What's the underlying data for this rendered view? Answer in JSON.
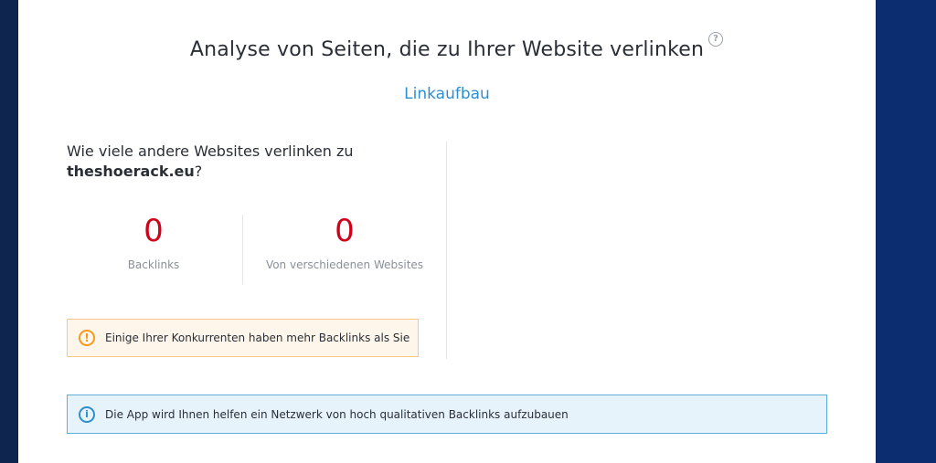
{
  "header": {
    "title": "Analyse von Seiten, die zu Ihrer Website verlinken",
    "help_icon_glyph": "?",
    "link_label": "Linkaufbau"
  },
  "question": {
    "prefix": "Wie viele andere Websites verlinken zu",
    "domain": "theshoerack.eu",
    "suffix": "?"
  },
  "stats": [
    {
      "value": "0",
      "label": "Backlinks"
    },
    {
      "value": "0",
      "label": "Von verschiedenen Websites"
    }
  ],
  "warning": {
    "icon": "exclamation-circle-icon",
    "glyph": "!",
    "text": "Einige Ihrer Konkurrenten haben mehr Backlinks als Sie",
    "color": "#f29b1d"
  },
  "info": {
    "icon": "info-circle-icon",
    "glyph": "i",
    "text": "Die App wird Ihnen helfen ein Netzwerk von hoch qualitativen Backlinks aufzubauen",
    "color": "#2e8fcf"
  },
  "colors": {
    "accent": "#2e8fcf",
    "stat_value": "#d0021b",
    "background": "#0d2d6a"
  }
}
